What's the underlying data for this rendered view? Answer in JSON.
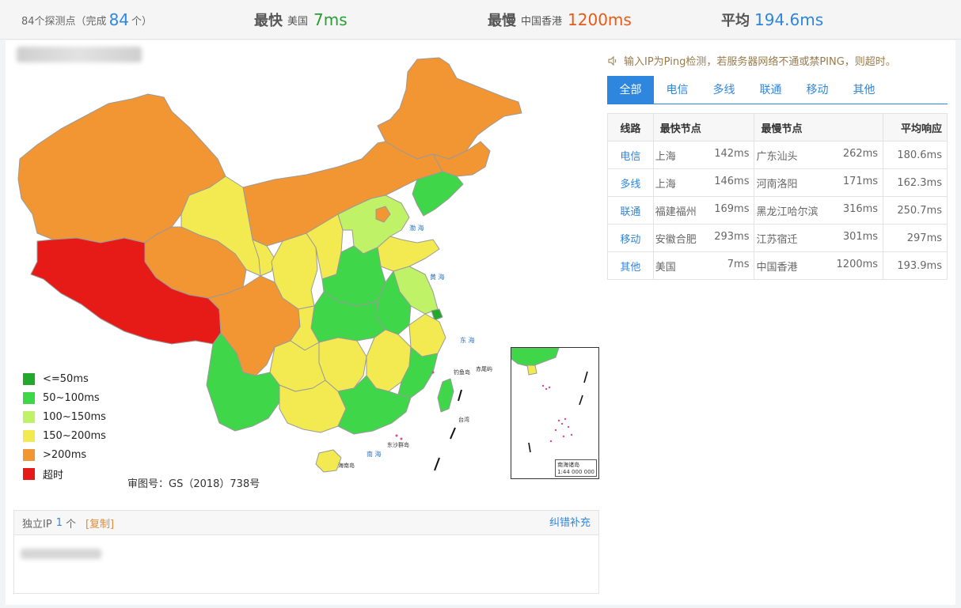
{
  "summary": {
    "probe_count_text": "84个探测点",
    "completed_prefix": "（完成",
    "completed_count": "84",
    "completed_suffix": "个）",
    "fastest_label": "最快",
    "fastest_location": "美国",
    "fastest_value": "7ms",
    "slowest_label": "最慢",
    "slowest_location": "中国香港",
    "slowest_value": "1200ms",
    "average_label": "平均",
    "average_value": "194.6ms"
  },
  "legend": [
    {
      "label": "<=50ms",
      "color": "#22a82a"
    },
    {
      "label": "50~100ms",
      "color": "#3fd64a"
    },
    {
      "label": "100~150ms",
      "color": "#bff266"
    },
    {
      "label": "150~200ms",
      "color": "#f2ea50"
    },
    {
      "label": ">200ms",
      "color": "#f29633"
    },
    {
      "label": "超时",
      "color": "#e61a17"
    }
  ],
  "map": {
    "approval_number": "审图号：GS（2018）738号",
    "inset_label": "南海诸岛",
    "inset_scale": "1:44 000 000",
    "labels": {
      "bohai": "渤 海",
      "huanghai": "黄 海",
      "donghai": "东 海",
      "nanhai": "南 海",
      "hainan": "海南岛",
      "dongsha": "东沙群岛",
      "diaoyu": "钓鱼岛",
      "chiwei": "赤尾屿",
      "taiwan": "台湾"
    }
  },
  "ip_section": {
    "label": "独立IP",
    "count": "1",
    "unit": "个",
    "copy": "[复制]",
    "fix": "纠错补充"
  },
  "notice": "输入IP为Ping检测，若服务器网络不通或禁PING，则超时。",
  "tabs": [
    "全部",
    "电信",
    "多线",
    "联通",
    "移动",
    "其他"
  ],
  "table": {
    "headers": {
      "line": "线路",
      "fastest": "最快节点",
      "slowest": "最慢节点",
      "average": "平均响应"
    },
    "rows": [
      {
        "line": "电信",
        "fast_node": "上海",
        "fast_ms": "142ms",
        "slow_node": "广东汕头",
        "slow_ms": "262ms",
        "avg": "180.6ms"
      },
      {
        "line": "多线",
        "fast_node": "上海",
        "fast_ms": "146ms",
        "slow_node": "河南洛阳",
        "slow_ms": "171ms",
        "avg": "162.3ms"
      },
      {
        "line": "联通",
        "fast_node": "福建福州",
        "fast_ms": "169ms",
        "slow_node": "黑龙江哈尔滨",
        "slow_ms": "316ms",
        "avg": "250.7ms"
      },
      {
        "line": "移动",
        "fast_node": "安徽合肥",
        "fast_ms": "293ms",
        "slow_node": "江苏宿迁",
        "slow_ms": "301ms",
        "avg": "297ms"
      },
      {
        "line": "其他",
        "fast_node": "美国",
        "fast_ms": "7ms",
        "slow_node": "中国香港",
        "slow_ms": "1200ms",
        "avg": "193.9ms"
      }
    ]
  }
}
